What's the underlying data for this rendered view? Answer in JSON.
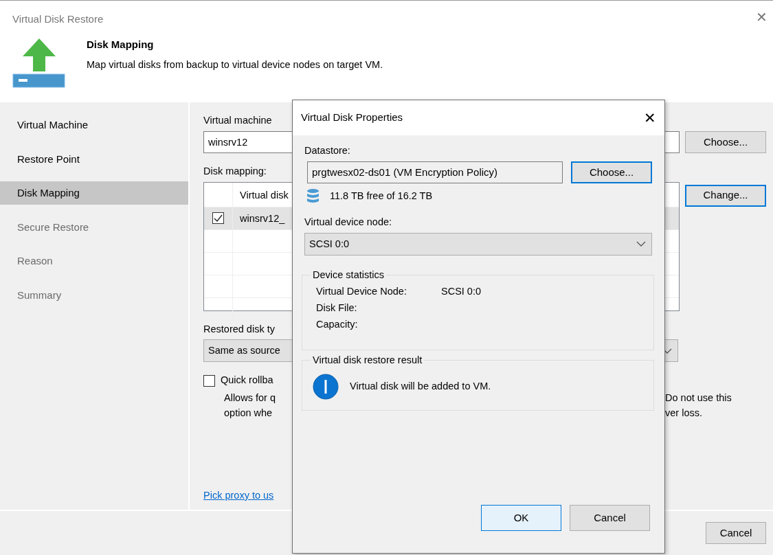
{
  "window": {
    "title": "Virtual Disk Restore",
    "close": "✕"
  },
  "header": {
    "title": "Disk Mapping",
    "subtitle": "Map virtual disks from backup to virtual device nodes on target VM."
  },
  "steps": [
    {
      "label": "Virtual Machine",
      "selected": false,
      "enabled": true
    },
    {
      "label": "Restore Point",
      "selected": false,
      "enabled": true
    },
    {
      "label": "Disk Mapping",
      "selected": true,
      "enabled": true
    },
    {
      "label": "Secure Restore",
      "selected": false,
      "enabled": false
    },
    {
      "label": "Reason",
      "selected": false,
      "enabled": false
    },
    {
      "label": "Summary",
      "selected": false,
      "enabled": false
    }
  ],
  "form": {
    "vm_label": "Virtual machine",
    "vm_value": "winsrv12",
    "choose_button": "Choose...",
    "disk_mapping_label": "Disk mapping:",
    "change_button": "Change...",
    "table": {
      "columns": [
        "Virtual disk"
      ],
      "rows": [
        {
          "cells": [
            "winsrv12_"
          ],
          "checked": true,
          "selected": true
        }
      ]
    },
    "disk_type_label": "Restored disk ty",
    "disk_type_value": "Same as source",
    "quick_rollback": {
      "label": "Quick rollba",
      "checked": false,
      "description_left": [
        "Allows for q",
        "option whe"
      ],
      "description_right": [
        "Do not use this",
        "ver loss."
      ]
    },
    "proxy_link": "Pick proxy to us"
  },
  "footer": {
    "buttons": [
      {
        "label": "Cancel"
      }
    ]
  },
  "dialog": {
    "title": "Virtual Disk Properties",
    "close": "✕",
    "datastore_label": "Datastore:",
    "datastore_value": "prgtwesx02-ds01 (VM Encryption Policy)",
    "choose_button": "Choose...",
    "free_space": "11.8 TB free of 16.2 TB",
    "node_label": "Virtual device node:",
    "node_value": "SCSI 0:0",
    "statistics": {
      "legend": "Device statistics",
      "rows": [
        {
          "label": "Virtual Device Node:",
          "value": "SCSI 0:0"
        },
        {
          "label": "Disk File:"
        },
        {
          "label": "Capacity:"
        }
      ]
    },
    "result": {
      "legend": "Virtual disk restore result",
      "message": "Virtual disk will be added to VM."
    },
    "buttons": [
      {
        "label": "OK",
        "default": true
      },
      {
        "label": "Cancel",
        "default": false
      }
    ]
  }
}
